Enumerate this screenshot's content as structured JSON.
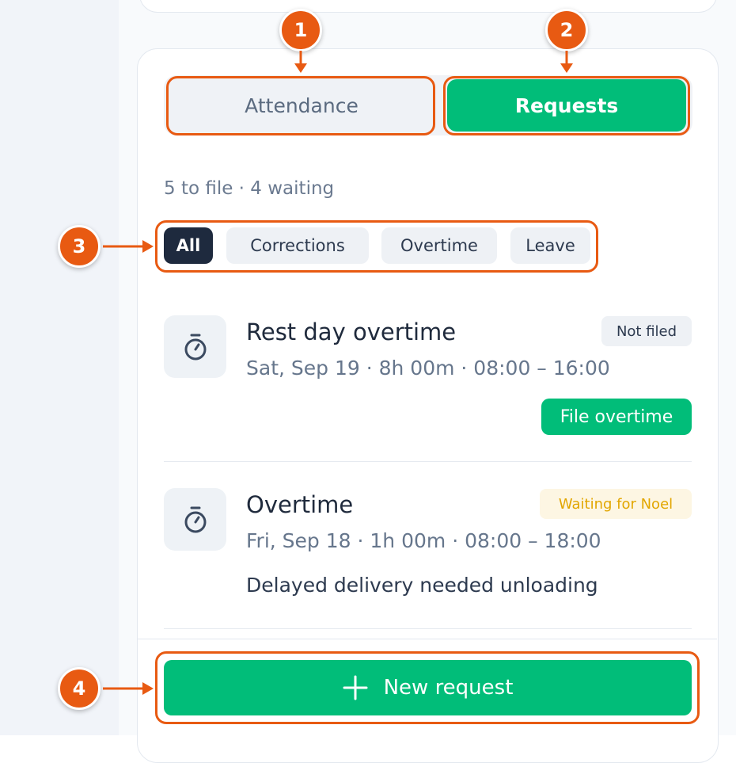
{
  "tabs": {
    "attendance": "Attendance",
    "requests": "Requests",
    "active": "requests"
  },
  "summary": "5 to file · 4 waiting",
  "filters": [
    "All",
    "Corrections",
    "Overtime",
    "Leave"
  ],
  "active_filter": "All",
  "requests": [
    {
      "icon": "stopwatch-icon",
      "title": "Rest day overtime",
      "meta": "Sat, Sep 19 · 8h 00m · 08:00 – 16:00",
      "status": "Not filed",
      "action": "File overtime"
    },
    {
      "icon": "stopwatch-icon",
      "title": "Overtime",
      "meta": "Fri, Sep 18 · 1h 00m · 08:00 – 18:00",
      "status": "Waiting for Noel",
      "note": "Delayed delivery needed unloading"
    }
  ],
  "new_request": "New request",
  "callouts": [
    "1",
    "2",
    "3",
    "4"
  ],
  "colors": {
    "accent": "#01bd79",
    "annotation": "#e85a12",
    "waiting": "#e2a600",
    "dark_chip": "#1e2a3e"
  }
}
